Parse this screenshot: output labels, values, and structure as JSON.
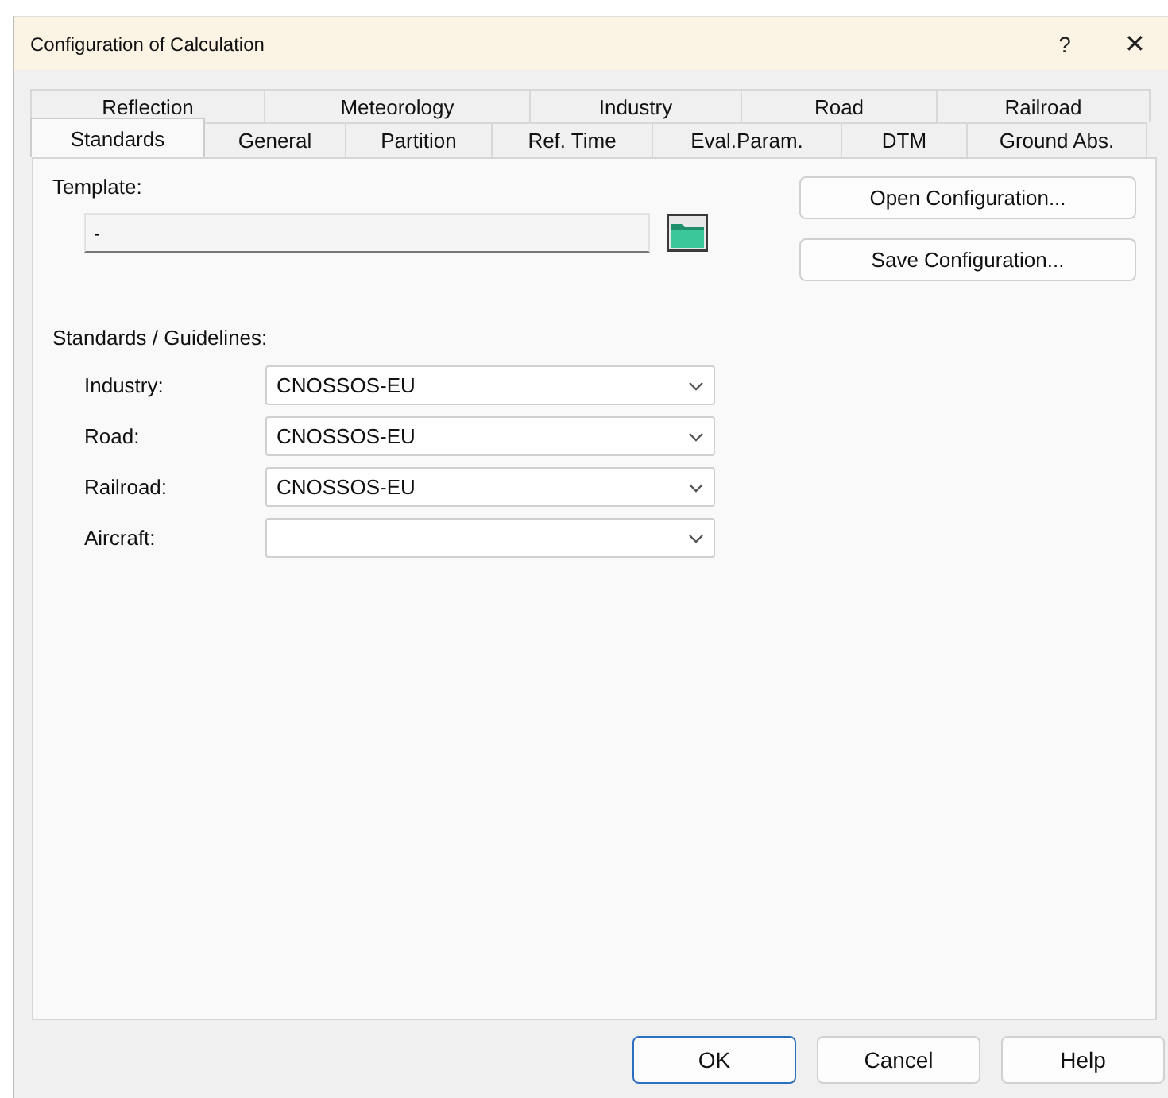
{
  "window": {
    "title": "Configuration of Calculation",
    "help": "?",
    "close": "✕"
  },
  "tab_rows": [
    [
      {
        "label": "Reflection",
        "selected": false
      },
      {
        "label": "Meteorology",
        "selected": false
      },
      {
        "label": "Industry",
        "selected": false
      },
      {
        "label": "Road",
        "selected": false
      },
      {
        "label": "Railroad",
        "selected": false
      }
    ],
    [
      {
        "label": "Standards",
        "selected": true
      },
      {
        "label": "General",
        "selected": false
      },
      {
        "label": "Partition",
        "selected": false
      },
      {
        "label": "Ref. Time",
        "selected": false
      },
      {
        "label": "Eval.Param.",
        "selected": false
      },
      {
        "label": "DTM",
        "selected": false
      },
      {
        "label": "Ground Abs.",
        "selected": false
      }
    ]
  ],
  "template": {
    "label": "Template:",
    "value": "-"
  },
  "config_buttons": [
    "Open Configuration...",
    "Save Configuration..."
  ],
  "standards": {
    "label": "Standards / Guidelines:",
    "rows": [
      {
        "label": "Industry:",
        "value": "CNOSSOS-EU"
      },
      {
        "label": "Road:",
        "value": "CNOSSOS-EU"
      },
      {
        "label": "Railroad:",
        "value": "CNOSSOS-EU"
      },
      {
        "label": "Aircraft:",
        "value": ""
      }
    ]
  },
  "buttons": [
    {
      "label": "OK",
      "default": true
    },
    {
      "label": "Cancel",
      "default": false
    },
    {
      "label": "Help",
      "default": false
    }
  ]
}
